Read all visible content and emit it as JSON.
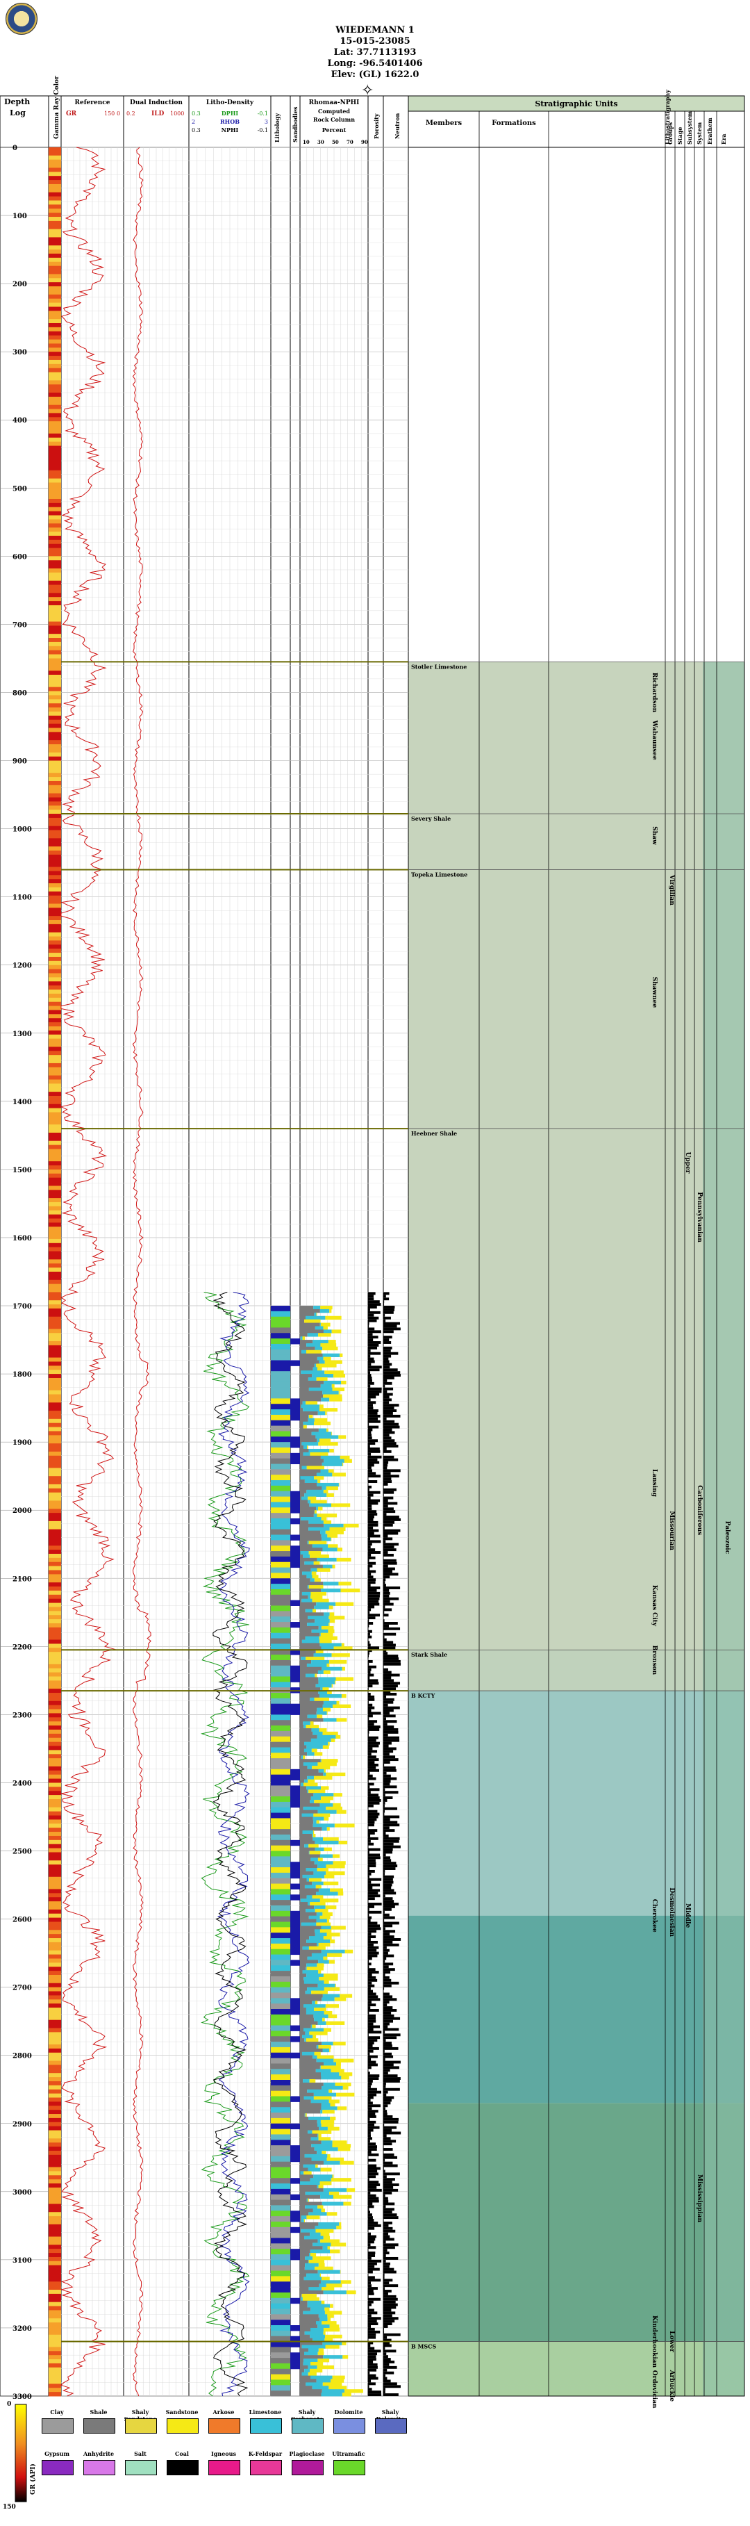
{
  "header": {
    "well_name": "WIEDEMANN 1",
    "api": "15-015-23085",
    "lat": "Lat: 37.7113193",
    "long": "Long: -96.5401406",
    "elev": "Elev: (GL) 1622.0"
  },
  "columns": {
    "depth": [
      "Depth",
      "Log"
    ],
    "gr_color": "Gamma Ray Color",
    "reference": {
      "title": "Reference",
      "curve": "GR",
      "min": "150",
      "max": "0"
    },
    "induction": {
      "title": "Dual Induction",
      "curve": "ILD",
      "min": "1000",
      "max": "0.2"
    },
    "density": {
      "title": "Litho-Density",
      "curves": [
        {
          "name": "DPHI",
          "left": "0.3",
          "right": "-0.1",
          "color": "#1a9a1a"
        },
        {
          "name": "RHOB",
          "left": "2",
          "right": "3",
          "color": "#1a1aa8"
        },
        {
          "name": "NPHI",
          "left": "0.3",
          "right": "-0.1",
          "color": "#000000"
        }
      ]
    },
    "lithology": "Lithology",
    "sandbodies": "Sandbodies",
    "rhomaa": {
      "title": "Rhomaa-NPHI",
      "sub": [
        "Computed",
        "Rock Column"
      ],
      "unit": "Percent",
      "ticks": [
        "10",
        "30",
        "50",
        "70",
        "90"
      ]
    },
    "porosity": "Porosity",
    "neutron": "Neutron",
    "strat": {
      "title": "Stratigraphic Units",
      "members": "Members",
      "formations": "Formations",
      "vertical": [
        "Groups",
        "Stage",
        "Subsystem",
        "System",
        "Erathem",
        "Era"
      ],
      "extra": "Lithostratigraphy"
    }
  },
  "depth_ticks": [
    "0",
    "100",
    "200",
    "300",
    "400",
    "500",
    "600",
    "700",
    "800",
    "900",
    "1000",
    "1100",
    "1200",
    "1300",
    "1400",
    "1500",
    "1600",
    "1700",
    "1800",
    "1900",
    "2000",
    "2100",
    "2200",
    "2300",
    "2400",
    "2500",
    "2600",
    "2700",
    "2800",
    "2900",
    "3000",
    "3100",
    "3200",
    "3300"
  ],
  "depth_range": [
    0,
    3300
  ],
  "members": [
    {
      "label": "Stotler Limestone",
      "depth": 755
    },
    {
      "label": "Severy Shale",
      "depth": 978
    },
    {
      "label": "Topeka Limestone",
      "depth": 1060
    },
    {
      "label": "Heebner Shale",
      "depth": 1440
    },
    {
      "label": "Stark Shale",
      "depth": 2205
    },
    {
      "label": "B KCTY",
      "depth": 2265
    },
    {
      "label": "B MSCS",
      "depth": 3220
    }
  ],
  "groups": [
    {
      "label": "Richardson",
      "depth_center": 800
    },
    {
      "label": "Wabaunsee",
      "depth_center": 870
    },
    {
      "label": "Shaw",
      "depth_center": 1010
    },
    {
      "label": "Shawnee",
      "depth_center": 1240
    },
    {
      "label": "Lansing",
      "depth_center": 1960
    },
    {
      "label": "Kansas City",
      "depth_center": 2140
    },
    {
      "label": "Bronson",
      "depth_center": 2220
    },
    {
      "label": "Cherokee",
      "depth_center": 2595
    },
    {
      "label": "Kinderhookian",
      "depth_center": 3220
    },
    {
      "label": "Ordovician",
      "depth_center": 3290
    }
  ],
  "stages": [
    {
      "label": "Virgilian",
      "depth_center": 1090
    },
    {
      "label": "Missourian",
      "depth_center": 2030
    },
    {
      "label": "Desmoinesian",
      "depth_center": 2590
    },
    {
      "label": "Lower",
      "depth_center": 3220
    },
    {
      "label": "Arbuckle",
      "depth_center": 3285
    }
  ],
  "subsystems": [
    {
      "label": "Upper",
      "depth_center": 1490
    },
    {
      "label": "Middle",
      "depth_center": 2595
    }
  ],
  "systems": [
    {
      "label": "Pennsylvanian",
      "depth_center": 1570
    },
    {
      "label": "Carboniferous",
      "depth_center": 2000
    },
    {
      "label": "Mississippian",
      "depth_center": 3010
    }
  ],
  "eras": [
    {
      "label": "Paleozoic",
      "depth_center": 2040
    }
  ],
  "legend": [
    {
      "label": "Clay",
      "color": "#9b9b9b"
    },
    {
      "label": "Shale",
      "color": "#7a7a7a"
    },
    {
      "label": "Shaly Sandstone",
      "color": "#e6d640"
    },
    {
      "label": "Sandstone",
      "color": "#f5e915"
    },
    {
      "label": "Arkose",
      "color": "#f07a2a"
    },
    {
      "label": "Limestone",
      "color": "#39c0d8"
    },
    {
      "label": "Shaly Carbonate",
      "color": "#5fb8c4"
    },
    {
      "label": "Dolomite",
      "color": "#7a8fe0"
    },
    {
      "label": "Shaly Dolomite",
      "color": "#5a6ac0"
    },
    {
      "label": "Gypsum",
      "color": "#8a2ac0"
    },
    {
      "label": "Anhydrite",
      "color": "#d878e8"
    },
    {
      "label": "Salt",
      "color": "#a0e0c0"
    },
    {
      "label": "Coal",
      "color": "#000000"
    },
    {
      "label": "Igneous",
      "color": "#e81a8a"
    },
    {
      "label": "K-Feldspar",
      "color": "#e83898"
    },
    {
      "label": "Plagioclase",
      "color": "#b01a9a"
    },
    {
      "label": "Ultramafic",
      "color": "#6ad82a"
    }
  ],
  "gr_scale": {
    "title": "GR (API)",
    "min": "0",
    "max": "150"
  }
}
